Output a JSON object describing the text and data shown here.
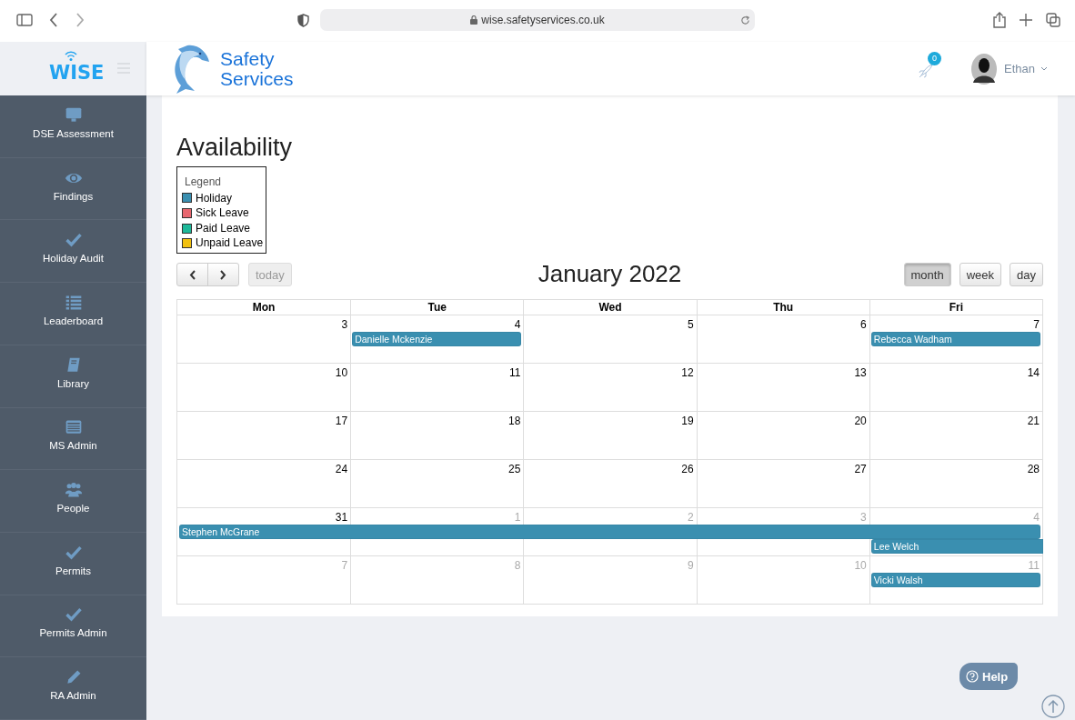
{
  "browser": {
    "url": "wise.safetyservices.co.uk"
  },
  "sidebar": {
    "logo": "WISE",
    "items": [
      {
        "label": "DSE Assessment"
      },
      {
        "label": "Findings"
      },
      {
        "label": "Holiday Audit"
      },
      {
        "label": "Leaderboard"
      },
      {
        "label": "Library"
      },
      {
        "label": "MS Admin"
      },
      {
        "label": "People"
      },
      {
        "label": "Permits"
      },
      {
        "label": "Permits Admin"
      },
      {
        "label": "RA Admin"
      }
    ]
  },
  "header": {
    "brand_lines": [
      "Safety",
      "Services"
    ],
    "notifications": {
      "count": "0"
    },
    "user": {
      "name": "Ethan"
    }
  },
  "page": {
    "title": "Availability"
  },
  "legend": {
    "title": "Legend",
    "items": [
      {
        "label": "Holiday",
        "color": "#3a8fb0"
      },
      {
        "label": "Sick Leave",
        "color": "#e8676f"
      },
      {
        "label": "Paid Leave",
        "color": "#1db899"
      },
      {
        "label": "Unpaid Leave",
        "color": "#f2c10f"
      }
    ]
  },
  "calendar": {
    "title": "January 2022",
    "today_button": {
      "label": "today",
      "disabled": true
    },
    "views": [
      {
        "label": "month",
        "selected": true
      },
      {
        "label": "week",
        "selected": false
      },
      {
        "label": "day",
        "selected": false
      }
    ],
    "columns": [
      "Mon",
      "Tue",
      "Wed",
      "Thu",
      "Fri"
    ],
    "weeks": [
      {
        "days": [
          {
            "date": "3",
            "other_month": false
          },
          {
            "date": "4",
            "other_month": false,
            "events": [
              {
                "name": "Danielle Mckenzie",
                "kind": "day",
                "continues": false,
                "color": "#3a8fb0"
              }
            ]
          },
          {
            "date": "5",
            "other_month": false
          },
          {
            "date": "6",
            "other_month": false
          },
          {
            "date": "7",
            "other_month": false,
            "events": [
              {
                "name": "Rebecca Wadham",
                "kind": "day",
                "continues": false,
                "color": "#3a8fb0"
              }
            ]
          }
        ]
      },
      {
        "days": [
          {
            "date": "10",
            "other_month": false
          },
          {
            "date": "11",
            "other_month": false
          },
          {
            "date": "12",
            "other_month": false
          },
          {
            "date": "13",
            "other_month": false
          },
          {
            "date": "14",
            "other_month": false
          }
        ]
      },
      {
        "days": [
          {
            "date": "17",
            "other_month": false
          },
          {
            "date": "18",
            "other_month": false
          },
          {
            "date": "19",
            "other_month": false
          },
          {
            "date": "20",
            "other_month": false
          },
          {
            "date": "21",
            "other_month": false
          }
        ]
      },
      {
        "days": [
          {
            "date": "24",
            "other_month": false
          },
          {
            "date": "25",
            "other_month": false
          },
          {
            "date": "26",
            "other_month": false
          },
          {
            "date": "27",
            "other_month": false
          },
          {
            "date": "28",
            "other_month": false
          }
        ]
      },
      {
        "days": [
          {
            "date": "31",
            "other_month": false,
            "events": [
              {
                "name": "Stephen McGrane",
                "kind": "rest_of_week",
                "continues": false,
                "color": "#3a8fb0"
              }
            ]
          },
          {
            "date": "1",
            "other_month": true
          },
          {
            "date": "2",
            "other_month": true
          },
          {
            "date": "3",
            "other_month": true
          },
          {
            "date": "4",
            "other_month": true,
            "events": [
              {
                "name": "Lee Welch",
                "kind": "rest_of_week",
                "continues": true,
                "color": "#3a8fb0"
              }
            ]
          }
        ]
      },
      {
        "days": [
          {
            "date": "7",
            "other_month": true
          },
          {
            "date": "8",
            "other_month": true
          },
          {
            "date": "9",
            "other_month": true
          },
          {
            "date": "10",
            "other_month": true
          },
          {
            "date": "11",
            "other_month": true,
            "events": [
              {
                "name": "Vicki Walsh",
                "kind": "day",
                "continues": false,
                "color": "#3a8fb0"
              }
            ]
          }
        ]
      }
    ]
  },
  "help": {
    "label": "Help"
  }
}
